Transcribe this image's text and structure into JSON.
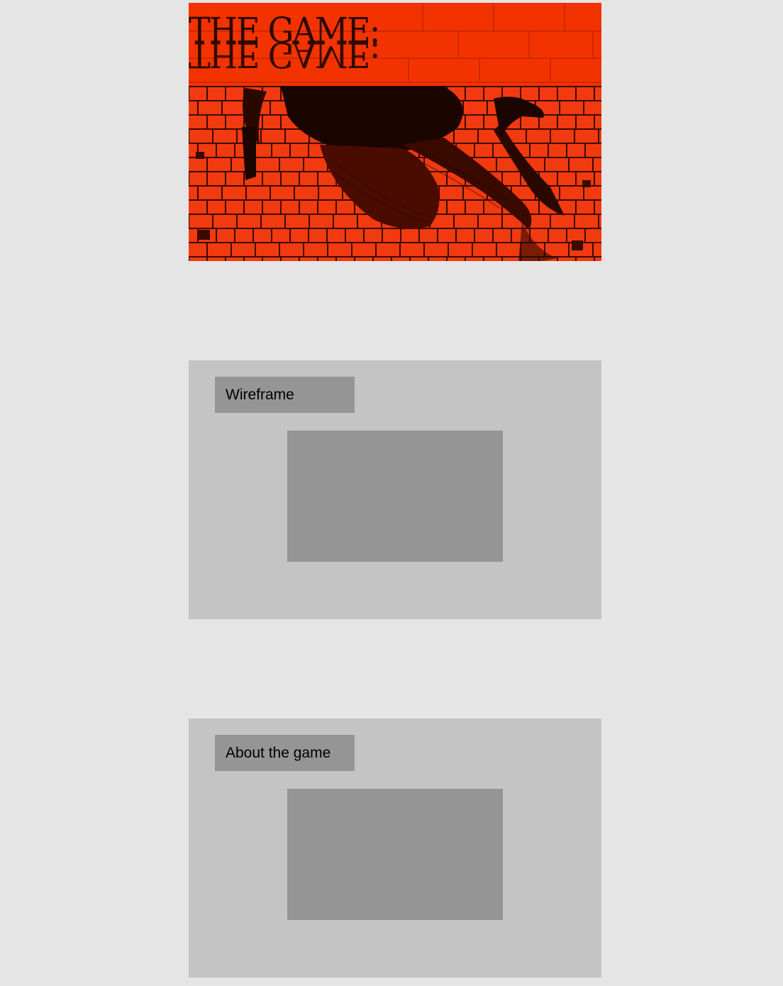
{
  "hero": {
    "title": "THE GAME:",
    "title_mirror": "THE GAME:",
    "accent_color": "#f02a00",
    "ink_color": "#1a0500"
  },
  "sections": [
    {
      "label": "Wireframe"
    },
    {
      "label": "About the game"
    }
  ],
  "colors": {
    "page_background": "#e5e5e5",
    "panel_background": "#c4c4c4",
    "placeholder": "#959595"
  }
}
